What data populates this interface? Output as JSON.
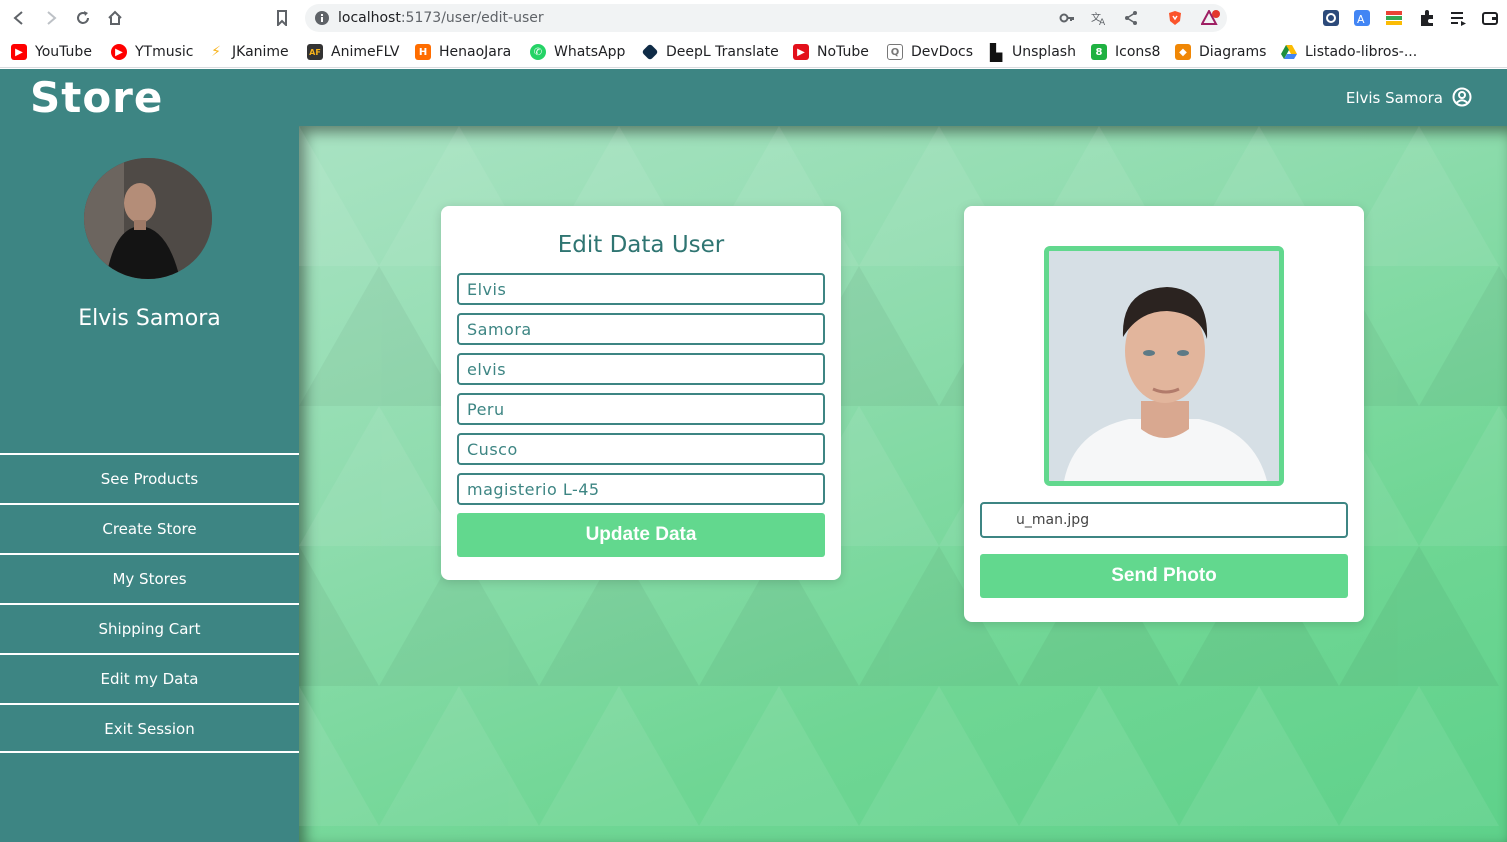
{
  "browser": {
    "url_host": "localhost",
    "url_path": ":5173/user/edit-user",
    "bookmarks": [
      {
        "label": "YouTube",
        "color": "#ff0000"
      },
      {
        "label": "YTmusic",
        "color": "#ff0000"
      },
      {
        "label": "JKanime",
        "color": "#f7b21b"
      },
      {
        "label": "AnimeFLV",
        "color": "#333333"
      },
      {
        "label": "HenaoJara",
        "color": "#ff6d00"
      },
      {
        "label": "WhatsApp",
        "color": "#25d366"
      },
      {
        "label": "DeepL Translate",
        "color": "#0f2b46"
      },
      {
        "label": "NoTube",
        "color": "#e3101b"
      },
      {
        "label": "DevDocs",
        "color": "#777777"
      },
      {
        "label": "Unsplash",
        "color": "#111111"
      },
      {
        "label": "Icons8",
        "color": "#1fb141"
      },
      {
        "label": "Diagrams",
        "color": "#f08705"
      },
      {
        "label": "Listado-libros-...",
        "color": "#1e8e3e"
      }
    ]
  },
  "header": {
    "brand": "Store",
    "user_name": "Elvis Samora"
  },
  "sidebar": {
    "user_name": "Elvis Samora",
    "menu": [
      "See Products",
      "Create Store",
      "My Stores",
      "Shipping Cart",
      "Edit my Data",
      "Exit Session"
    ]
  },
  "edit_form": {
    "title": "Edit Data User",
    "fields": [
      "Elvis",
      "Samora",
      "elvis",
      "Peru",
      "Cusco",
      "magisterio L-45"
    ],
    "submit": "Update Data"
  },
  "photo_form": {
    "file_name": "u_man.jpg",
    "submit": "Send Photo"
  },
  "colors": {
    "primary": "#3d8583",
    "accent": "#62d88e"
  }
}
